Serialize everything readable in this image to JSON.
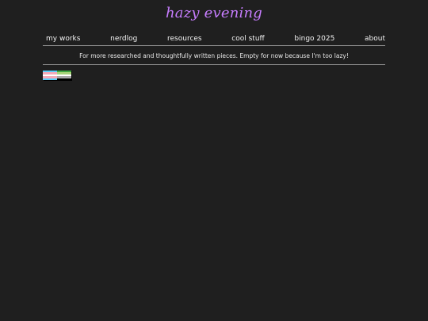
{
  "site": {
    "title": "hazy evening"
  },
  "nav": {
    "items": [
      {
        "label": "my works"
      },
      {
        "label": "nerdlog"
      },
      {
        "label": "resources"
      },
      {
        "label": "cool stuff"
      },
      {
        "label": "bingo 2025"
      },
      {
        "label": "about"
      }
    ]
  },
  "main": {
    "intro": "For more researched and thoughtfully written pieces. Empty for now because I'm too lazy!"
  },
  "badges": [
    {
      "name": "trans-flag",
      "colors": [
        "#5bcefa",
        "#f5a9b8",
        "#ffffff",
        "#f5a9b8",
        "#5bcefa"
      ]
    },
    {
      "name": "aromantic-flag",
      "colors": [
        "#3da542",
        "#a7d379",
        "#ffffff",
        "#a9a9a9",
        "#000000"
      ]
    }
  ],
  "colors": {
    "background": "#1f1f1f",
    "accent": "#c77dff",
    "text": "#f2f2f2",
    "rule": "#8a8a8a"
  }
}
